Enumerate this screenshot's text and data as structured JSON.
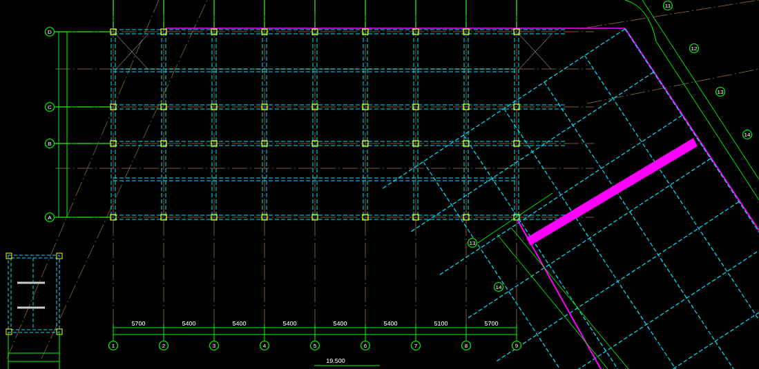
{
  "drawing": {
    "title": "19.500",
    "row_axes": [
      {
        "label": "D"
      },
      {
        "label": "C"
      },
      {
        "label": "B"
      },
      {
        "label": "A"
      }
    ],
    "column_axes": [
      {
        "label": "1"
      },
      {
        "label": "2"
      },
      {
        "label": "3"
      },
      {
        "label": "4"
      },
      {
        "label": "5"
      },
      {
        "label": "6"
      },
      {
        "label": "7"
      },
      {
        "label": "8"
      },
      {
        "label": "9"
      }
    ],
    "bay_dimensions": [
      "5700",
      "5400",
      "5400",
      "5400",
      "5400",
      "5400",
      "5100",
      "5700"
    ],
    "wing_axes_right": [
      {
        "label": "11"
      },
      {
        "label": "12"
      },
      {
        "label": "13"
      },
      {
        "label": "14"
      }
    ],
    "wing_axes_left": [
      {
        "label": "13"
      },
      {
        "label": "14"
      }
    ]
  }
}
